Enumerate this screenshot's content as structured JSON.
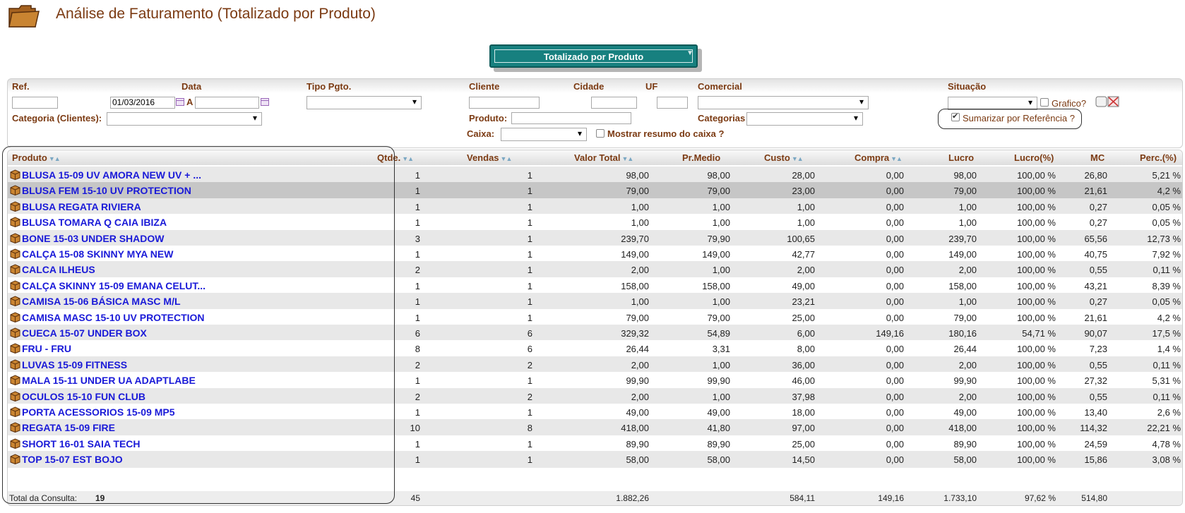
{
  "page": {
    "title": "Análise de Faturamento (Totalizado por Produto)"
  },
  "view_select": {
    "value": "Totalizado por Produto"
  },
  "filters": {
    "ref_label": "Ref.",
    "data_label": "Data",
    "data_from": "01/03/2016",
    "a_label": "A",
    "tipo_pgto_label": "Tipo Pgto.",
    "cliente_label": "Cliente",
    "cidade_label": "Cidade",
    "uf_label": "UF",
    "comercial_label": "Comercial",
    "situacao_label": "Situação",
    "grafico_label": "Grafico?",
    "categoria_clientes_label": "Categoria (Clientes):",
    "produto_label": "Produto:",
    "categorias_label": "Categorias",
    "sumarizar_label": "Sumarizar por Referência ?",
    "sumarizar_checked": true,
    "caixa_label": "Caixa:",
    "mostrar_resumo_label": "Mostrar resumo do caixa ?"
  },
  "table": {
    "headers": {
      "produto": "Produto",
      "qtde": "Qtde.",
      "vendas": "Vendas",
      "valor_total": "Valor Total",
      "pr_medio": "Pr.Medio",
      "custo": "Custo",
      "compra": "Compra",
      "lucro": "Lucro",
      "lucro_pct": "Lucro(%)",
      "mc": "MC",
      "perc": "Perc.(%)"
    },
    "rows": [
      {
        "produto": "BLUSA 15-09 UV AMORA NEW UV + ...",
        "qtde": "1",
        "vendas": "1",
        "valor_total": "98,00",
        "pr_medio": "98,00",
        "custo": "28,00",
        "compra": "0,00",
        "lucro": "98,00",
        "lucro_pct": "100,00 %",
        "mc": "26,80",
        "perc": "5,21 %"
      },
      {
        "produto": "BLUSA FEM 15-10 UV PROTECTION",
        "qtde": "1",
        "vendas": "1",
        "valor_total": "79,00",
        "pr_medio": "79,00",
        "custo": "23,00",
        "compra": "0,00",
        "lucro": "79,00",
        "lucro_pct": "100,00 %",
        "mc": "21,61",
        "perc": "4,2 %"
      },
      {
        "produto": "BLUSA REGATA RIVIERA",
        "qtde": "1",
        "vendas": "1",
        "valor_total": "1,00",
        "pr_medio": "1,00",
        "custo": "1,00",
        "compra": "0,00",
        "lucro": "1,00",
        "lucro_pct": "100,00 %",
        "mc": "0,27",
        "perc": "0,05 %"
      },
      {
        "produto": "BLUSA TOMARA Q CAIA IBIZA",
        "qtde": "1",
        "vendas": "1",
        "valor_total": "1,00",
        "pr_medio": "1,00",
        "custo": "1,00",
        "compra": "0,00",
        "lucro": "1,00",
        "lucro_pct": "100,00 %",
        "mc": "0,27",
        "perc": "0,05 %"
      },
      {
        "produto": "BONE 15-03 UNDER SHADOW",
        "qtde": "3",
        "vendas": "1",
        "valor_total": "239,70",
        "pr_medio": "79,90",
        "custo": "100,65",
        "compra": "0,00",
        "lucro": "239,70",
        "lucro_pct": "100,00 %",
        "mc": "65,56",
        "perc": "12,73 %"
      },
      {
        "produto": "CALÇA 15-08 SKINNY MYA NEW",
        "qtde": "1",
        "vendas": "1",
        "valor_total": "149,00",
        "pr_medio": "149,00",
        "custo": "42,77",
        "compra": "0,00",
        "lucro": "149,00",
        "lucro_pct": "100,00 %",
        "mc": "40,75",
        "perc": "7,92 %"
      },
      {
        "produto": "CALCA ILHEUS",
        "qtde": "2",
        "vendas": "1",
        "valor_total": "2,00",
        "pr_medio": "1,00",
        "custo": "2,00",
        "compra": "0,00",
        "lucro": "2,00",
        "lucro_pct": "100,00 %",
        "mc": "0,55",
        "perc": "0,11 %"
      },
      {
        "produto": "CALÇA SKINNY 15-09 EMANA CELUT...",
        "qtde": "1",
        "vendas": "1",
        "valor_total": "158,00",
        "pr_medio": "158,00",
        "custo": "49,00",
        "compra": "0,00",
        "lucro": "158,00",
        "lucro_pct": "100,00 %",
        "mc": "43,21",
        "perc": "8,39 %"
      },
      {
        "produto": "CAMISA 15-06 BÁSICA MASC M/L",
        "qtde": "1",
        "vendas": "1",
        "valor_total": "1,00",
        "pr_medio": "1,00",
        "custo": "23,21",
        "compra": "0,00",
        "lucro": "1,00",
        "lucro_pct": "100,00 %",
        "mc": "0,27",
        "perc": "0,05 %"
      },
      {
        "produto": "CAMISA MASC 15-10 UV PROTECTION",
        "qtde": "1",
        "vendas": "1",
        "valor_total": "79,00",
        "pr_medio": "79,00",
        "custo": "25,00",
        "compra": "0,00",
        "lucro": "79,00",
        "lucro_pct": "100,00 %",
        "mc": "21,61",
        "perc": "4,2 %"
      },
      {
        "produto": "CUECA 15-07 UNDER BOX",
        "qtde": "6",
        "vendas": "6",
        "valor_total": "329,32",
        "pr_medio": "54,89",
        "custo": "6,00",
        "compra": "149,16",
        "lucro": "180,16",
        "lucro_pct": "54,71 %",
        "mc": "90,07",
        "perc": "17,5 %"
      },
      {
        "produto": "FRU - FRU",
        "qtde": "8",
        "vendas": "6",
        "valor_total": "26,44",
        "pr_medio": "3,31",
        "custo": "8,00",
        "compra": "0,00",
        "lucro": "26,44",
        "lucro_pct": "100,00 %",
        "mc": "7,23",
        "perc": "1,4 %"
      },
      {
        "produto": "LUVAS 15-09 FITNESS",
        "qtde": "2",
        "vendas": "2",
        "valor_total": "2,00",
        "pr_medio": "1,00",
        "custo": "36,00",
        "compra": "0,00",
        "lucro": "2,00",
        "lucro_pct": "100,00 %",
        "mc": "0,55",
        "perc": "0,11 %"
      },
      {
        "produto": "MALA 15-11 UNDER UA ADAPTLABE",
        "qtde": "1",
        "vendas": "1",
        "valor_total": "99,90",
        "pr_medio": "99,90",
        "custo": "46,00",
        "compra": "0,00",
        "lucro": "99,90",
        "lucro_pct": "100,00 %",
        "mc": "27,32",
        "perc": "5,31 %"
      },
      {
        "produto": "OCULOS 15-10 FUN CLUB",
        "qtde": "2",
        "vendas": "2",
        "valor_total": "2,00",
        "pr_medio": "1,00",
        "custo": "37,98",
        "compra": "0,00",
        "lucro": "2,00",
        "lucro_pct": "100,00 %",
        "mc": "0,55",
        "perc": "0,11 %"
      },
      {
        "produto": "PORTA ACESSORIOS 15-09 MP5",
        "qtde": "1",
        "vendas": "1",
        "valor_total": "49,00",
        "pr_medio": "49,00",
        "custo": "18,00",
        "compra": "0,00",
        "lucro": "49,00",
        "lucro_pct": "100,00 %",
        "mc": "13,40",
        "perc": "2,6 %"
      },
      {
        "produto": "REGATA 15-09 FIRE",
        "qtde": "10",
        "vendas": "8",
        "valor_total": "418,00",
        "pr_medio": "41,80",
        "custo": "97,00",
        "compra": "0,00",
        "lucro": "418,00",
        "lucro_pct": "100,00 %",
        "mc": "114,32",
        "perc": "22,21 %"
      },
      {
        "produto": "SHORT 16-01 SAIA TECH",
        "qtde": "1",
        "vendas": "1",
        "valor_total": "89,90",
        "pr_medio": "89,90",
        "custo": "25,00",
        "compra": "0,00",
        "lucro": "89,90",
        "lucro_pct": "100,00 %",
        "mc": "24,59",
        "perc": "4,78 %"
      },
      {
        "produto": "TOP 15-07 EST BOJO",
        "qtde": "1",
        "vendas": "1",
        "valor_total": "58,00",
        "pr_medio": "58,00",
        "custo": "14,50",
        "compra": "0,00",
        "lucro": "58,00",
        "lucro_pct": "100,00 %",
        "mc": "15,86",
        "perc": "3,08 %"
      }
    ],
    "selected_row_index": 1,
    "total": {
      "label": "Total da Consulta:",
      "count": "19",
      "qtde": "45",
      "valor_total": "1.882,26",
      "custo": "584,11",
      "compra": "149,16",
      "lucro": "1.733,10",
      "lucro_pct": "97,62 %",
      "mc": "514,80"
    }
  },
  "icons": {
    "title_icon": "folder-icon",
    "row_icon": "product-box-icon",
    "calendar": "calendar-icon",
    "grafico": "chart-toggle-icon",
    "clear": "clear-filters-icon"
  },
  "colors": {
    "title": "#7b3a12",
    "label": "#7b3a12",
    "link": "#1a1ad8",
    "view_select_bg": "#17807f",
    "row_alt": "#e8e8e8",
    "row_selected": "#c6c6c6"
  }
}
